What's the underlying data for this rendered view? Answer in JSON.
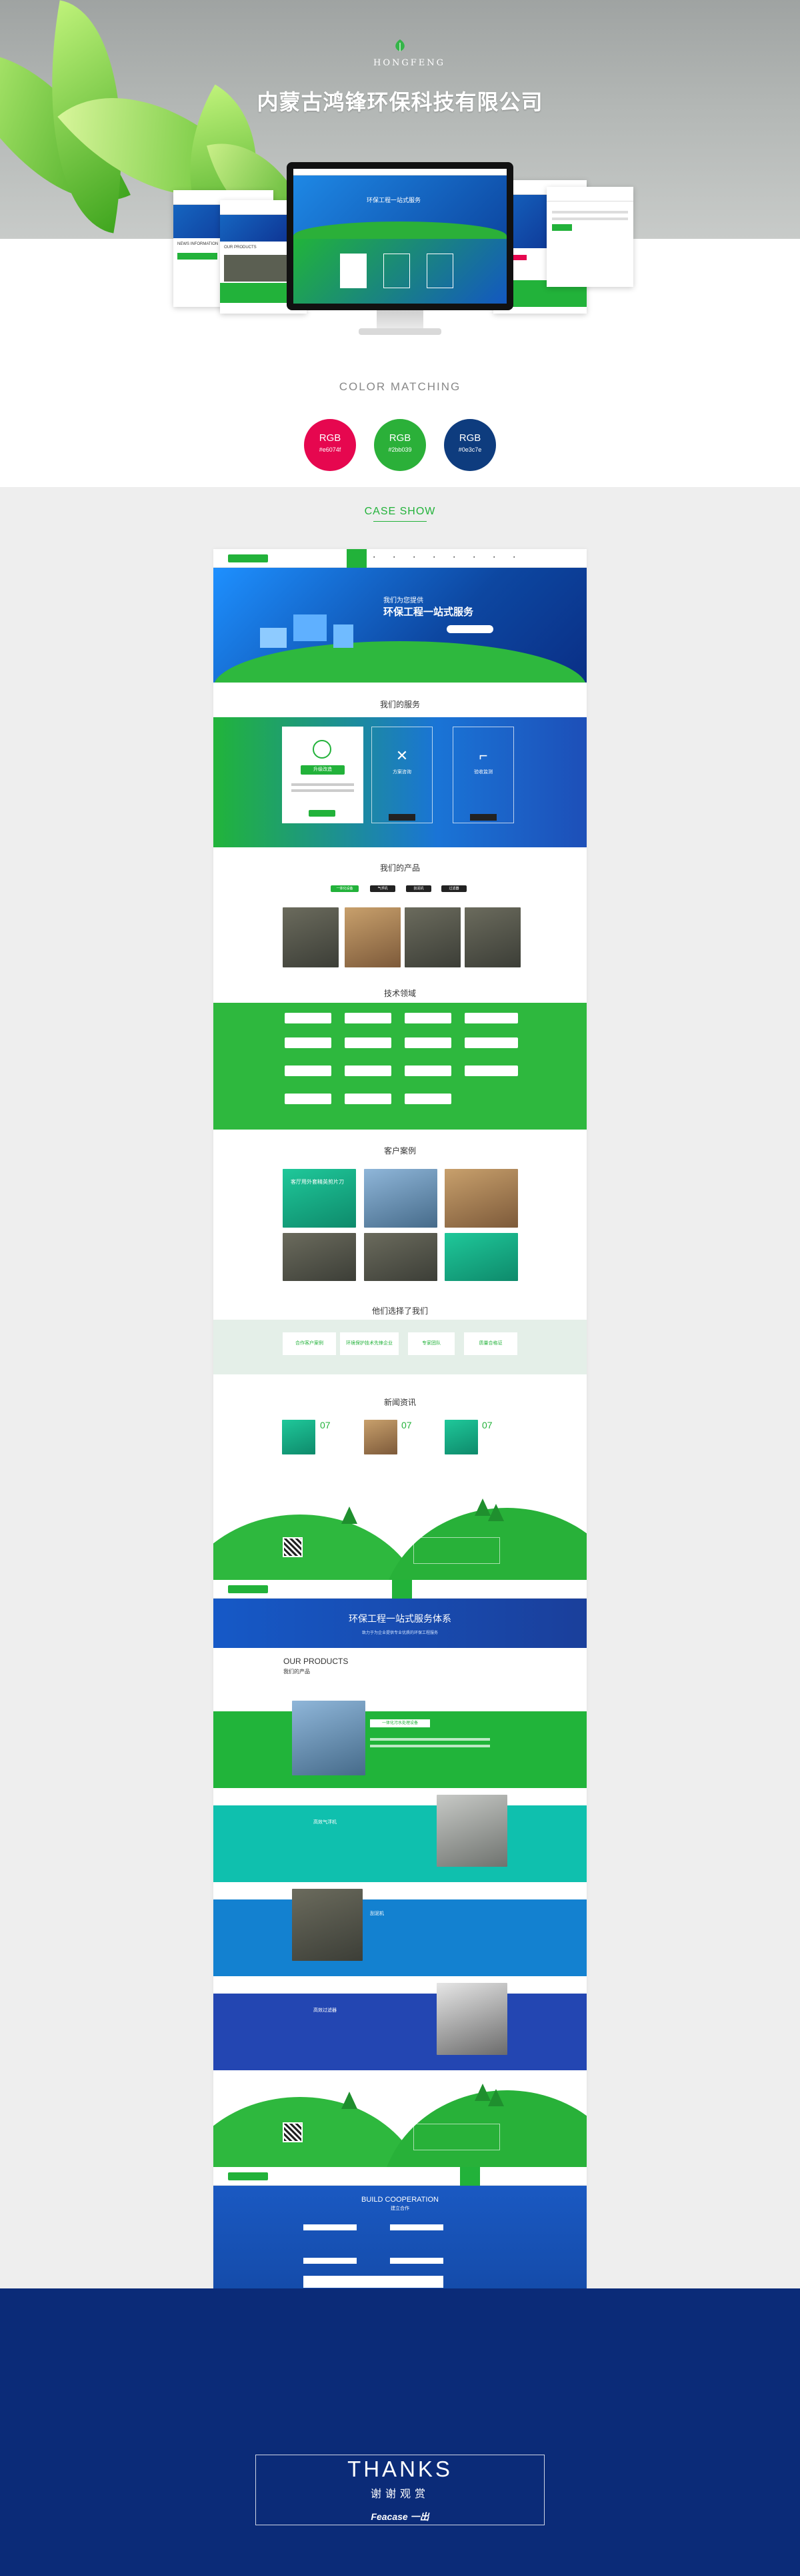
{
  "hero": {
    "logo_text": "HONGFENG",
    "company_name": "内蒙古鸿锋环保科技有限公司",
    "mockups": {
      "left_card_1": "NEWS INFORMATION",
      "left_card_2": "OUR PRODUCTS",
      "monitor_slogan": "环保工程一站式服务"
    }
  },
  "color_matching": {
    "title": "COLOR  MATCHING",
    "swatches": [
      {
        "rgb": "RGB",
        "hex": "#e6074f",
        "color": "#e6074f"
      },
      {
        "rgb": "RGB",
        "hex": "#2bb039",
        "color": "#2bb039"
      },
      {
        "rgb": "RGB",
        "hex": "#0e3c7e",
        "color": "#0e3c7e"
      }
    ]
  },
  "case_show": {
    "title": "CASE SHOW",
    "home": {
      "banner_small": "我们为您提供",
      "banner_large": "环保工程一站式服务",
      "services_title": "我们的服务",
      "services": [
        "升级改造",
        "方案咨询",
        "验收监测"
      ],
      "products_title": "我们的产品",
      "product_tabs": [
        "一体化设备",
        "气浮机",
        "刮泥机",
        "过滤器"
      ],
      "tech_title": "技术领域",
      "cases_title": "客户案例",
      "case_feature": "客厅用外套精英剪片刀",
      "why_title": "他们选择了我们",
      "why_items": [
        "合作客户案例",
        "环境保护技术先锋企业",
        "专家团队",
        "质量合格证"
      ],
      "news_title": "新闻资讯",
      "news_days": [
        "07",
        "07",
        "07"
      ]
    },
    "products": {
      "banner_title": "环保工程一站式服务体系",
      "banner_sub": "致力于为企业提供专业优质的环保工程服务",
      "heading_en": "OUR PRODUCTS",
      "heading_cn": "我们的产品",
      "bands": [
        {
          "title": "一体化污水处理设备",
          "color": "#21b43a"
        },
        {
          "title": "高效气浮机",
          "color": "#0fc0ae"
        },
        {
          "title": "刮泥机",
          "color": "#1381d0"
        },
        {
          "title": "高效过滤器",
          "color": "#2346b2"
        }
      ]
    },
    "contact": {
      "heading_en": "BUILD COOPERATION",
      "heading_cn": "建立合作",
      "submit": "提交"
    }
  },
  "thanks": {
    "word": "THANKS",
    "cn": "谢谢观赏",
    "brand": "Feacase 一出"
  }
}
